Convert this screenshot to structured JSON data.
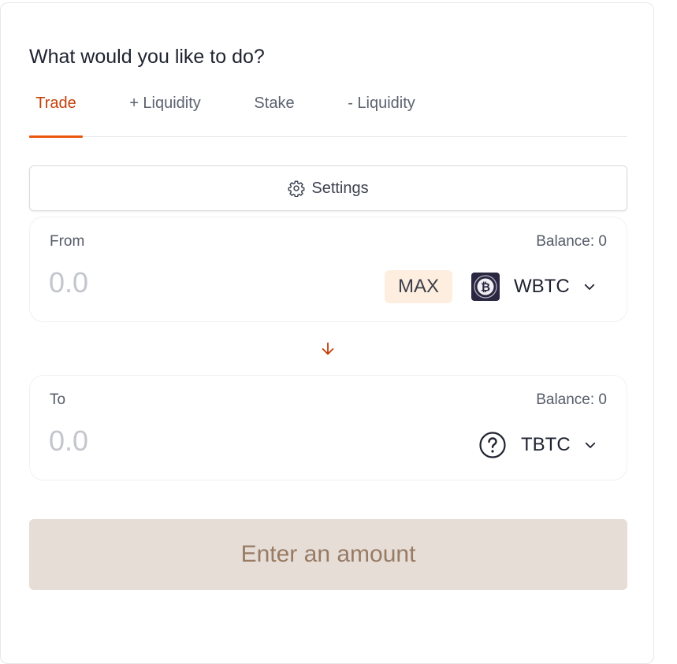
{
  "heading": "What would you like to do?",
  "tabs": [
    {
      "label": "Trade",
      "active": true
    },
    {
      "label": "+ Liquidity",
      "active": false
    },
    {
      "label": "Stake",
      "active": false
    },
    {
      "label": "- Liquidity",
      "active": false
    }
  ],
  "settings": {
    "label": "Settings",
    "icon": "gear-icon"
  },
  "from": {
    "label": "From",
    "balance": "Balance: 0",
    "amount_placeholder": "0.0",
    "max_label": "MAX",
    "token": {
      "symbol": "WBTC",
      "icon": "wbtc-token-icon"
    }
  },
  "swap_icon": "arrow-down-icon",
  "to": {
    "label": "To",
    "balance": "Balance: 0",
    "amount_placeholder": "0.0",
    "token": {
      "symbol": "TBTC",
      "icon": "question-circle-icon"
    }
  },
  "submit_label": "Enter an amount",
  "colors": {
    "accent": "#ea580c",
    "active_tab_text": "#c2410c",
    "max_bg": "#fdeee0",
    "submit_bg": "#e7ddd7",
    "submit_text": "#977b64"
  }
}
